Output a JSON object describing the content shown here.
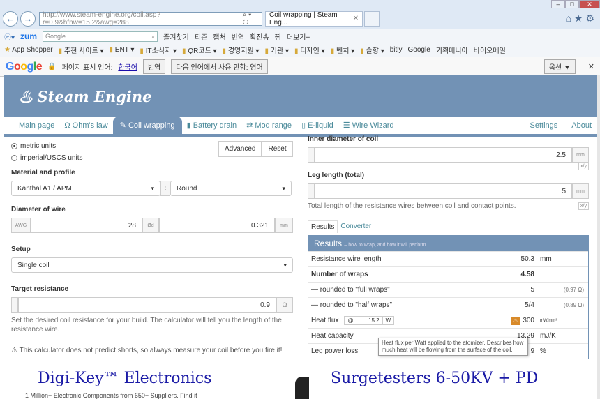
{
  "browser": {
    "url": "http://www.steam-engine.org/coil.asp?r=0.9&hfnw=15.2&awg=288",
    "tab_title": "Coil wrapping | Steam Eng...",
    "zum_label": "zum",
    "search_placeholder": "Google",
    "toolbar1_items": [
      "즐겨찾기",
      "티존",
      "캡처",
      "번역",
      "확전송",
      "찜",
      "더보기+"
    ],
    "bookmarks": [
      "App Shopper",
      "추천 사이트",
      "ENT",
      "IT소식지",
      "QR코드",
      "경영지원",
      "기관",
      "디자인",
      "벤처",
      "솔향",
      "bitly",
      "Google",
      "기획매니아",
      "바이오메일"
    ]
  },
  "google_bar": {
    "lang_prefix": "페이지 표시 언어:",
    "lang": "한국어",
    "translate_btn": "번역",
    "never_btn": "다음 언어에서 사용 안함: 영어",
    "options_btn": "옵션 ▼"
  },
  "site": {
    "brand": "Steam Engine",
    "menu": {
      "main": "Main page",
      "ohms": "Ω Ohm's law",
      "coil": "Coil wrapping",
      "battery": "Battery drain",
      "mod": "Mod range",
      "eliquid": "E-liquid",
      "wire": "Wire Wizard",
      "settings": "Settings",
      "about": "About"
    }
  },
  "form": {
    "units_metric": "metric units",
    "units_imperial": "imperial/USCS units",
    "advanced": "Advanced",
    "reset": "Reset",
    "material_label": "Material and profile",
    "material": "Kanthal A1 / APM",
    "profile": "Round",
    "diameter_label": "Diameter of wire",
    "awg_label": "AWG",
    "awg": "28",
    "diameter_addon": "Ød",
    "diameter": "0.321",
    "diameter_unit": "mm",
    "setup_label": "Setup",
    "setup": "Single coil",
    "target_label": "Target resistance",
    "target": "0.9",
    "target_unit": "Ω",
    "target_help": "Set the desired coil resistance for your build. The calculator will tell you the length of the resistance wire.",
    "warning": "This calculator does not predict shorts, so always measure your coil before you fire it!",
    "inner_label": "Inner diameter of coil",
    "inner": "2.5",
    "inner_unit": "mm",
    "leg_label": "Leg length (total)",
    "leg": "5",
    "leg_unit": "mm",
    "leg_help": "Total length of the resistance wires between coil and contact points.",
    "xy_label": "x/y"
  },
  "results": {
    "tab_results": "Results",
    "tab_converter": "Converter",
    "head": "Results",
    "head_sub": "– how to wrap, and how it will perform",
    "rows": [
      {
        "label": "Resistance wire length",
        "value": "50.3",
        "unit": "mm",
        "extra": ""
      },
      {
        "label": "Number of wraps",
        "value": "4.58",
        "unit": "",
        "extra": ""
      },
      {
        "label": "— rounded to \"full wraps\"",
        "value": "5",
        "unit": "",
        "extra": "(0.97 Ω)"
      },
      {
        "label": "— rounded to \"half wraps\"",
        "value": "5/4",
        "unit": "",
        "extra": "(0.89 Ω)"
      }
    ],
    "heat_flux_label": "Heat flux",
    "heat_at": "@",
    "heat_watts": "15.2",
    "heat_w": "W",
    "heat_value": "300",
    "heat_unit": "mW/mm²",
    "capacity_label": "Heat capacity",
    "capacity_value": "13.29",
    "capacity_unit": "mJ/K",
    "legloss_label": "Leg power loss",
    "legloss_value": "9",
    "legloss_unit": "%",
    "tooltip": "Heat flux per Watt applied to the atomizer. Describes how much heat will be flowing from the surface of the coil."
  },
  "ads": {
    "ad1": "Digi-Key™ Electronics",
    "ad1_sub": "1 Million+ Electronic Components from 650+ Suppliers. Find it",
    "ad2": "Surgetesters 6-50KV + PD"
  }
}
